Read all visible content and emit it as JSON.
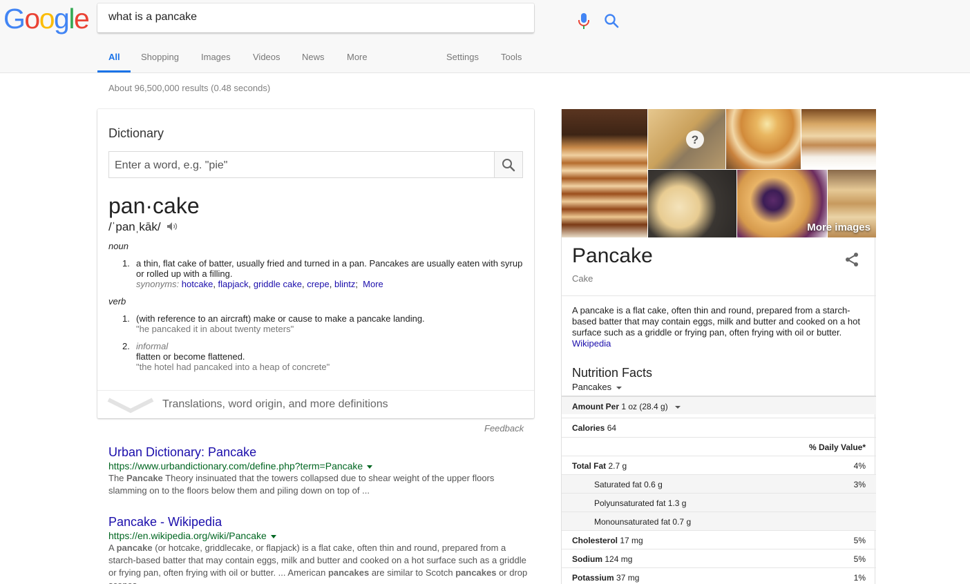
{
  "search": {
    "query": "what is a pancake"
  },
  "tabs": [
    "All",
    "Shopping",
    "Images",
    "Videos",
    "News",
    "More",
    "Settings",
    "Tools"
  ],
  "result_stats": "About 96,500,000 results (0.48 seconds)",
  "dictionary": {
    "title": "Dictionary",
    "input_placeholder": "Enter a word, e.g. \"pie\"",
    "headword": "pan·cake",
    "pronunciation": "/ˈpanˌkāk/",
    "noun": {
      "pos": "noun",
      "def1_num": "1.",
      "def1_text": "a thin, flat cake of batter, usually fried and turned in a pan. Pancakes are usually eaten with syrup or rolled up with a filling.",
      "synonyms_label": "synonyms:",
      "synonyms": [
        "hotcake",
        "flapjack",
        "griddle cake",
        "crepe",
        "blintz"
      ],
      "more_label": "More"
    },
    "verb": {
      "pos": "verb",
      "def1_num": "1.",
      "def1_text": "(with reference to an aircraft) make or cause to make a pancake landing.",
      "def1_example": "\"he pancaked it in about twenty meters\"",
      "def2_num": "2.",
      "def2_register": "informal",
      "def2_text": "flatten or become flattened.",
      "def2_example": "\"the hotel had pancaked into a heap of concrete\""
    },
    "footer": "Translations, word origin, and more definitions",
    "feedback": "Feedback"
  },
  "results": [
    {
      "title": "Urban Dictionary: Pancake",
      "url": "https://www.urbandictionary.com/define.php?term=Pancake",
      "snippet_pre": "The ",
      "snippet_bold": "Pancake",
      "snippet_post": " Theory insinuated that the towers collapsed due to shear weight of the upper floors slamming on to the floors below them and piling down on top of ..."
    },
    {
      "title": "Pancake - Wikipedia",
      "url": "https://en.wikipedia.org/wiki/Pancake",
      "snippet_1": "A ",
      "snippet_b1": "pancake",
      "snippet_2": " (or hotcake, griddlecake, or flapjack) is a flat cake, often thin and round, prepared from a starch-based batter that may contain eggs, milk and butter and cooked on a hot surface such as a griddle or frying pan, often frying with oil or butter. ... American ",
      "snippet_b2": "pancakes",
      "snippet_3": " are similar to Scotch ",
      "snippet_b3": "pancakes",
      "snippet_4": " or drop scones."
    }
  ],
  "knowledge_panel": {
    "more_images": "More images",
    "title": "Pancake",
    "subtitle": "Cake",
    "description": "A pancake is a flat cake, often thin and round, prepared from a starch-based batter that may contain eggs, milk and butter and cooked on a hot surface such as a griddle or frying pan, often frying with oil or butter.",
    "source_link": "Wikipedia",
    "nutrition": {
      "title": "Nutrition Facts",
      "food": "Pancakes",
      "amount_label": "Amount Per",
      "amount_value": "1 oz (28.4 g)",
      "calories_label": "Calories",
      "calories_value": "64",
      "daily_value_header": "% Daily Value*",
      "rows": [
        {
          "label": "Total Fat",
          "value": "2.7 g",
          "pct": "4%"
        },
        {
          "label": "Saturated fat",
          "value": "0.6 g",
          "pct": "3%"
        },
        {
          "label": "Polyunsaturated fat",
          "value": "1.3 g",
          "pct": ""
        },
        {
          "label": "Monounsaturated fat",
          "value": "0.7 g",
          "pct": ""
        },
        {
          "label": "Cholesterol",
          "value": "17 mg",
          "pct": "5%"
        },
        {
          "label": "Sodium",
          "value": "124 mg",
          "pct": "5%"
        },
        {
          "label": "Potassium",
          "value": "37 mg",
          "pct": "1%"
        }
      ]
    }
  },
  "colors": {
    "link": "#1a0dab",
    "url_green": "#006621",
    "tab_active": "#1a73e8",
    "google_blue": "#4285f4",
    "google_red": "#ea4335",
    "google_yellow": "#fbbc05",
    "google_green": "#34a853"
  }
}
